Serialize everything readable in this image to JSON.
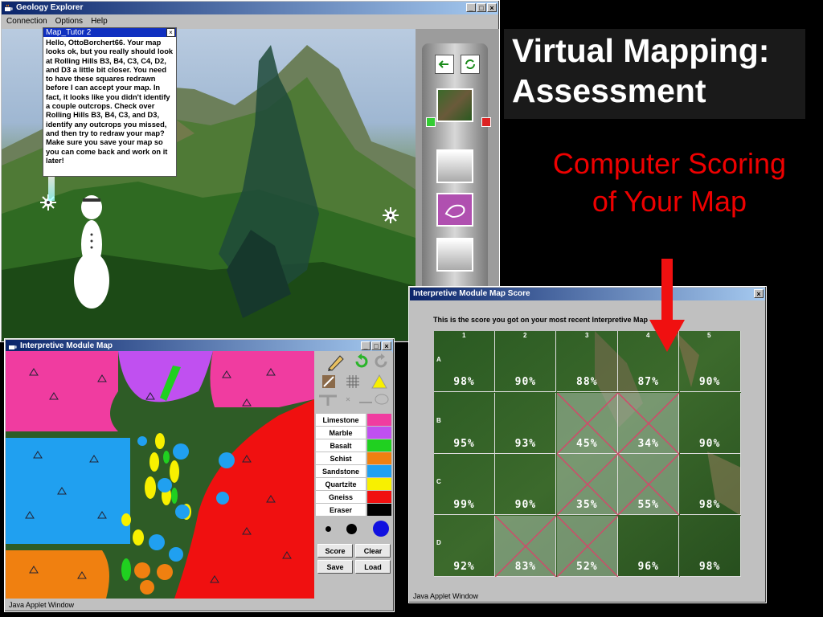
{
  "geology_window": {
    "title": "Geology Explorer",
    "menu": [
      "Connection",
      "Options",
      "Help"
    ],
    "buttons": {
      "minimize": "_",
      "maximize": "□",
      "close": "×"
    }
  },
  "tutor": {
    "header": "Map_Tutor 2",
    "message": "Hello, OttoBorchert66. Your map looks ok, but you really should look at Rolling Hills B3, B4, C3, C4, D2, and D3 a little bit closer. You need to have these squares redrawn before I can accept your map. In fact, it looks like you didn't identify a couple outcrops. Check over Rolling Hills B3, B4, C3, and D3, identify any outcrops you missed, and then try to redraw your map? Make sure you save your map so you can come back and work on it later!"
  },
  "map_window": {
    "title": "Interpretive Module Map",
    "status": "Java Applet Window",
    "legend": [
      {
        "label": "Limestone",
        "color": "#f03ca0"
      },
      {
        "label": "Marble",
        "color": "#c050f0"
      },
      {
        "label": "Basalt",
        "color": "#20d020"
      },
      {
        "label": "Schist",
        "color": "#f08010"
      },
      {
        "label": "Sandstone",
        "color": "#20a0f0"
      },
      {
        "label": "Quartzite",
        "color": "#f8f000"
      },
      {
        "label": "Gneiss",
        "color": "#f01010"
      },
      {
        "label": "Eraser",
        "color": "#000000"
      }
    ],
    "buttons": {
      "score": "Score",
      "clear": "Clear",
      "save": "Save",
      "load": "Load"
    }
  },
  "score_window": {
    "title": "Interpretive Module Map Score",
    "intro": "This is the score you got on your most recent Interpretive Map",
    "status": "Java Applet Window",
    "columns": [
      "1",
      "2",
      "3",
      "4",
      "5"
    ],
    "rows": [
      {
        "label": "A",
        "scores": [
          "98%",
          "90%",
          "88%",
          "87%",
          "90%"
        ],
        "bad": [
          false,
          false,
          false,
          false,
          false
        ]
      },
      {
        "label": "B",
        "scores": [
          "95%",
          "93%",
          "45%",
          "34%",
          "90%"
        ],
        "bad": [
          false,
          false,
          true,
          true,
          false
        ]
      },
      {
        "label": "C",
        "scores": [
          "99%",
          "90%",
          "35%",
          "55%",
          "98%"
        ],
        "bad": [
          false,
          false,
          true,
          true,
          false
        ]
      },
      {
        "label": "D",
        "scores": [
          "92%",
          "83%",
          "52%",
          "96%",
          "98%"
        ],
        "bad": [
          false,
          true,
          true,
          false,
          false
        ]
      }
    ]
  },
  "slide": {
    "title_line1": "Virtual Mapping:",
    "title_line2": "Assessment",
    "subtitle": "Computer Scoring of Your Map"
  }
}
